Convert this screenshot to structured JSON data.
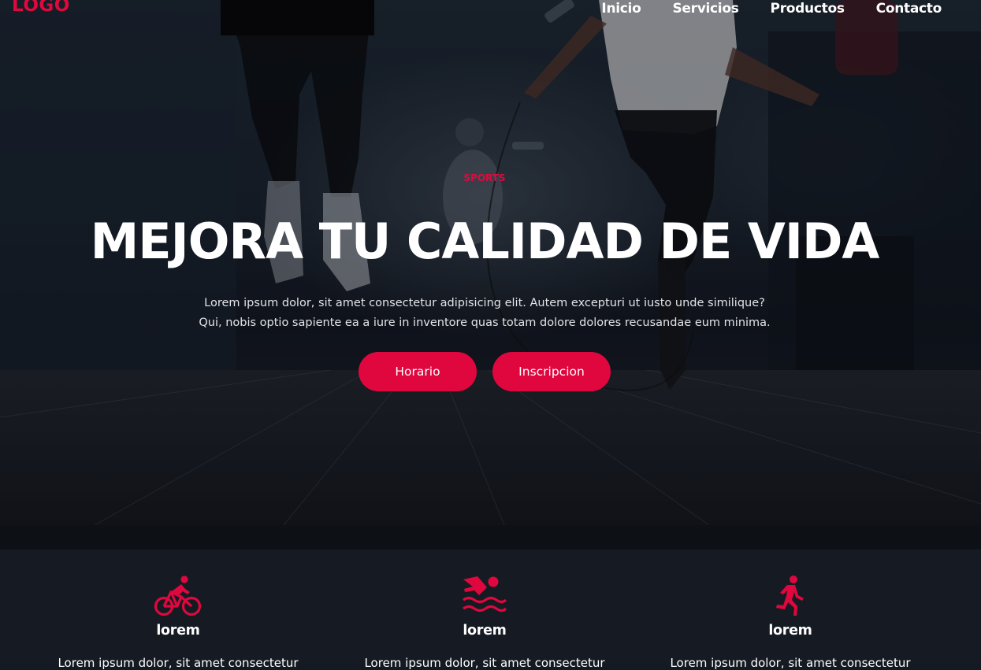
{
  "brand": {
    "logo": "LOGO"
  },
  "nav": {
    "items": [
      "Inicio",
      "Servicios",
      "Productos",
      "Contacto"
    ]
  },
  "hero": {
    "kicker": "SPORTS",
    "headline": "MEJORA TU CALIDAD DE VIDA",
    "lead_line1": "Lorem ipsum dolor, sit amet consectetur adipisicing elit. Autem excepturi ut iusto unde similique?",
    "lead_line2": "Qui, nobis optio sapiente ea a iure in inventore quas totam dolore dolores recusandae eum minima.",
    "buttons": [
      "Horario",
      "Inscripcion"
    ]
  },
  "features": [
    {
      "icon": "bicycle-icon",
      "title": "lorem",
      "text": "Lorem ipsum dolor, sit amet consectetur"
    },
    {
      "icon": "swimming-icon",
      "title": "lorem",
      "text": "Lorem ipsum dolor, sit amet consectetur"
    },
    {
      "icon": "running-icon",
      "title": "lorem",
      "text": "Lorem ipsum dolor, sit amet consectetur"
    }
  ],
  "colors": {
    "accent": "#e0073e",
    "hero_bg": "#1a242f",
    "features_bg": "#161b23",
    "strip_bg": "#0d1116",
    "text": "#ffffff"
  }
}
